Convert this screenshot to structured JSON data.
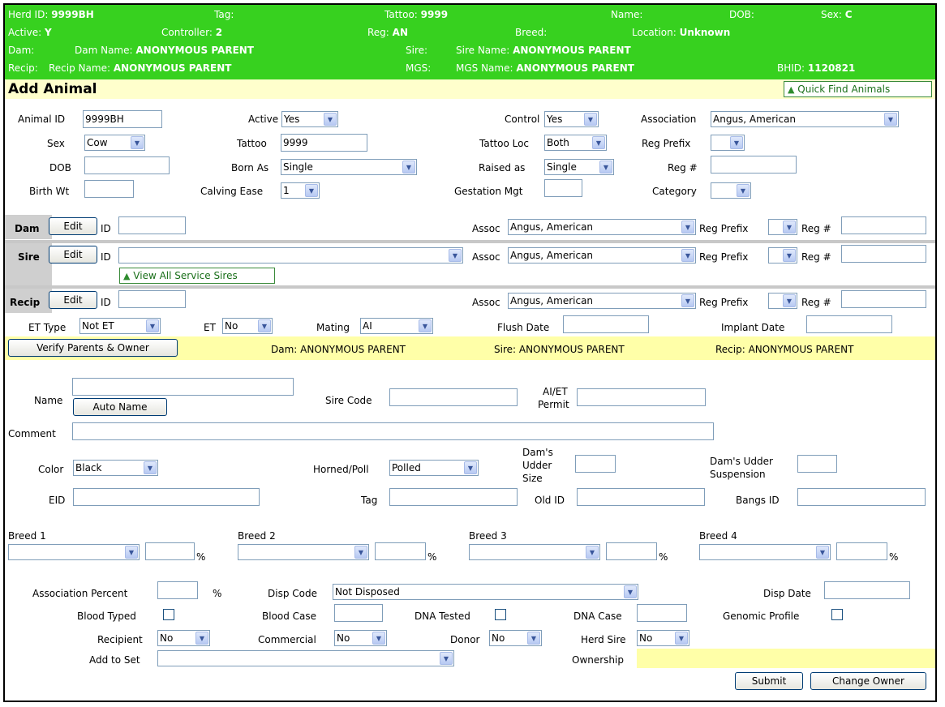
{
  "header": {
    "herd_id_label": "Herd ID:",
    "herd_id": "9999BH",
    "tag_label": "Tag:",
    "tattoo_label": "Tattoo:",
    "tattoo": "9999",
    "name_label": "Name:",
    "dob_label": "DOB:",
    "sex_label": "Sex:",
    "sex": "C",
    "active_label": "Active:",
    "active": "Y",
    "controller_label": "Controller:",
    "controller": "2",
    "reg_label": "Reg:",
    "reg": "AN",
    "breed_label": "Breed:",
    "location_label": "Location:",
    "location": "Unknown",
    "dam_label": "Dam:",
    "dam_name_label": "Dam Name:",
    "dam_name": "ANONYMOUS PARENT",
    "sire_label": "Sire:",
    "sire_name_label": "Sire Name:",
    "sire_name": "ANONYMOUS PARENT",
    "recip_label": "Recip:",
    "recip_name_label": "Recip Name:",
    "recip_name": "ANONYMOUS PARENT",
    "mgs_label": "MGS:",
    "mgs_name_label": "MGS Name:",
    "mgs_name": "ANONYMOUS PARENT",
    "bhid_label": "BHID:",
    "bhid": "1120821",
    "bg_color": "#37d11f"
  },
  "title": "Add Animal",
  "quick_find_label": "Quick Find Animals",
  "form": {
    "animal_id_label": "Animal ID",
    "animal_id": "9999BH",
    "active_label": "Active",
    "active": "Yes",
    "control_label": "Control",
    "control": "Yes",
    "association_label": "Association",
    "association": "Angus, American",
    "sex_label": "Sex",
    "sex": "Cow",
    "tattoo_label": "Tattoo",
    "tattoo": "9999",
    "tattoo_loc_label": "Tattoo Loc",
    "tattoo_loc": "Both",
    "reg_prefix_label": "Reg Prefix",
    "dob_label": "DOB",
    "born_as_label": "Born As",
    "born_as": "Single",
    "raised_as_label": "Raised as",
    "raised_as": "Single",
    "reg_num_label": "Reg #",
    "birth_wt_label": "Birth Wt",
    "calving_ease_label": "Calving Ease",
    "calving_ease": "1",
    "gestation_mgt_label": "Gestation Mgt",
    "category_label": "Category"
  },
  "parents": {
    "dam_label": "Dam",
    "sire_label": "Sire",
    "recip_label": "Recip",
    "edit_label": "Edit",
    "id_label": "ID",
    "assoc_label": "Assoc",
    "assoc_value": "Angus, American",
    "reg_prefix_label": "Reg Prefix",
    "reg_num_label": "Reg #",
    "view_all_sires_label": "View All Service Sires"
  },
  "et": {
    "et_type_label": "ET Type",
    "et_type": "Not ET",
    "et_label": "ET",
    "et": "No",
    "mating_label": "Mating",
    "mating": "AI",
    "flush_date_label": "Flush Date",
    "implant_date_label": "Implant Date"
  },
  "verify": {
    "button_label": "Verify Parents & Owner",
    "dam_text": "Dam: ANONYMOUS PARENT",
    "sire_text": "Sire: ANONYMOUS PARENT",
    "recip_text": "Recip: ANONYMOUS PARENT"
  },
  "details": {
    "name_label": "Name",
    "auto_name_label": "Auto Name",
    "sire_code_label": "Sire Code",
    "ai_et_permit_label_1": "AI/ET",
    "ai_et_permit_label_2": "Permit",
    "comment_label": "Comment",
    "color_label": "Color",
    "color": "Black",
    "horned_poll_label": "Horned/Poll",
    "horned_poll": "Polled",
    "dams_udder_size_1": "Dam's",
    "dams_udder_size_2": "Udder",
    "dams_udder_size_3": "Size",
    "dams_udder_susp_1": "Dam's Udder",
    "dams_udder_susp_2": "Suspension",
    "eid_label": "EID",
    "tag_label": "Tag",
    "old_id_label": "Old ID",
    "bangs_id_label": "Bangs ID"
  },
  "breeds": {
    "breed1_label": "Breed 1",
    "breed2_label": "Breed 2",
    "breed3_label": "Breed 3",
    "breed4_label": "Breed 4",
    "pct": "%"
  },
  "misc": {
    "assoc_percent_label": "Association Percent",
    "pct": "%",
    "disp_code_label": "Disp Code",
    "disp_code": "Not Disposed",
    "disp_date_label": "Disp Date",
    "blood_typed_label": "Blood Typed",
    "blood_case_label": "Blood Case",
    "dna_tested_label": "DNA Tested",
    "dna_case_label": "DNA Case",
    "genomic_profile_label": "Genomic Profile",
    "recipient_label": "Recipient",
    "recipient": "No",
    "commercial_label": "Commercial",
    "commercial": "No",
    "donor_label": "Donor",
    "donor": "No",
    "herd_sire_label": "Herd Sire",
    "herd_sire": "No",
    "add_to_set_label": "Add to Set",
    "ownership_label": "Ownership",
    "submit_label": "Submit",
    "change_owner_label": "Change Owner"
  },
  "icons": {
    "dropdown": "chevron-down-icon",
    "quick_find": "triangle-up-icon"
  }
}
